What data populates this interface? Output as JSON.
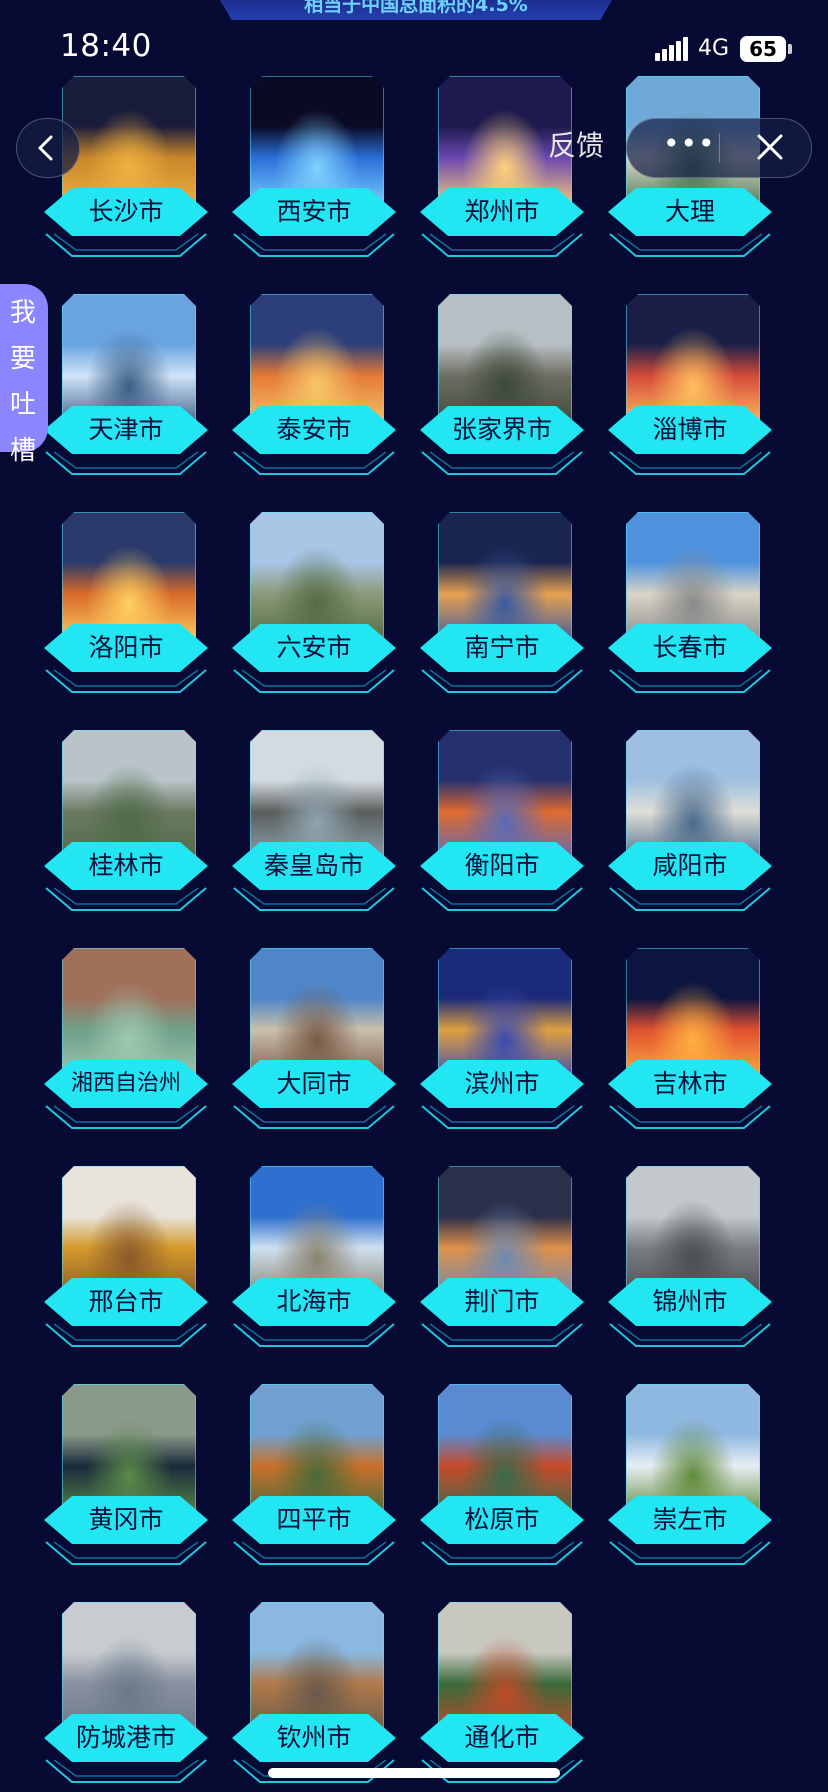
{
  "banner": {
    "text": "相当于中国总面积的4.5%"
  },
  "status_bar": {
    "time": "18:40",
    "network": "4G",
    "battery": "65"
  },
  "controls": {
    "feedback_label": "反馈",
    "more_label": "•••"
  },
  "side_tab": {
    "chars": [
      "我",
      "要",
      "吐",
      "槽"
    ]
  },
  "cities": [
    {
      "name": "长沙市",
      "palette": [
        "#1a1c3c",
        "#c8862a",
        "#f0b040"
      ]
    },
    {
      "name": "西安市",
      "palette": [
        "#0a0a24",
        "#2a6fd8",
        "#7fd0ff"
      ]
    },
    {
      "name": "郑州市",
      "palette": [
        "#1e1a4e",
        "#6a48b0",
        "#ffd27a"
      ]
    },
    {
      "name": "大理",
      "palette": [
        "#6fa9d8",
        "#d9d5c8",
        "#4b7a53"
      ]
    },
    {
      "name": "天津市",
      "palette": [
        "#6aa4e0",
        "#cfe4f8",
        "#3b5f86"
      ]
    },
    {
      "name": "泰安市",
      "palette": [
        "#2d3f7a",
        "#e47a35",
        "#f6c66a"
      ]
    },
    {
      "name": "张家界市",
      "palette": [
        "#b8bfc4",
        "#6e6e62",
        "#3d4a3a"
      ]
    },
    {
      "name": "淄博市",
      "palette": [
        "#1b1f48",
        "#d44b3a",
        "#ffc060"
      ]
    },
    {
      "name": "洛阳市",
      "palette": [
        "#2a3a6a",
        "#d86a2a",
        "#ffd060"
      ]
    },
    {
      "name": "六安市",
      "palette": [
        "#a8c6e6",
        "#8a9a7a",
        "#556b45"
      ]
    },
    {
      "name": "南宁市",
      "palette": [
        "#1a2550",
        "#e7a050",
        "#3a5aa0"
      ]
    },
    {
      "name": "长春市",
      "palette": [
        "#4f93de",
        "#d9d4c6",
        "#8a8a8a"
      ]
    },
    {
      "name": "桂林市",
      "palette": [
        "#b9c4c9",
        "#6b7a62",
        "#4f6b48"
      ]
    },
    {
      "name": "秦皇岛市",
      "palette": [
        "#d3dbe1",
        "#5a5e5c",
        "#8fa4b0"
      ]
    },
    {
      "name": "衡阳市",
      "palette": [
        "#26306e",
        "#e06a30",
        "#5a6ab8"
      ]
    },
    {
      "name": "咸阳市",
      "palette": [
        "#9fbfe0",
        "#e0dfd8",
        "#4a6a8a"
      ]
    },
    {
      "name": "湘西自治州",
      "palette": [
        "#a0705a",
        "#6fa08a",
        "#9fc7b0"
      ]
    },
    {
      "name": "大同市",
      "palette": [
        "#4f86c8",
        "#c9c0aa",
        "#7a5a48"
      ]
    },
    {
      "name": "滨州市",
      "palette": [
        "#1c2a7a",
        "#e0a040",
        "#3a4ab0"
      ]
    },
    {
      "name": "吉林市",
      "palette": [
        "#0c1440",
        "#e05030",
        "#ffb040"
      ]
    },
    {
      "name": "邢台市",
      "palette": [
        "#e8e4da",
        "#d49a2a",
        "#8a5a2a"
      ]
    },
    {
      "name": "北海市",
      "palette": [
        "#2e6fd0",
        "#cfe0f0",
        "#8a8470"
      ]
    },
    {
      "name": "荆门市",
      "palette": [
        "#2a2f4a",
        "#e0904a",
        "#6f8ab0"
      ]
    },
    {
      "name": "锦州市",
      "palette": [
        "#c2c8cc",
        "#7a7e80",
        "#4a4e50"
      ]
    },
    {
      "name": "黄冈市",
      "palette": [
        "#8a9a8a",
        "#1a2a3a",
        "#5a8a4a"
      ]
    },
    {
      "name": "四平市",
      "palette": [
        "#6fa0d0",
        "#c8702a",
        "#4a6a3a"
      ]
    },
    {
      "name": "松原市",
      "palette": [
        "#5a8ad0",
        "#c84a2a",
        "#3a6a4a"
      ]
    },
    {
      "name": "崇左市",
      "palette": [
        "#8fb8e0",
        "#e8eef4",
        "#5f8a3a"
      ]
    },
    {
      "name": "防城港市",
      "palette": [
        "#c8ccd0",
        "#8a90a0",
        "#6a7a8a"
      ]
    },
    {
      "name": "钦州市",
      "palette": [
        "#8ab8e0",
        "#b07a4a",
        "#6a5a4a"
      ]
    },
    {
      "name": "通化市",
      "palette": [
        "#c8c8c0",
        "#3a6a3a",
        "#c04a2a"
      ]
    }
  ]
}
